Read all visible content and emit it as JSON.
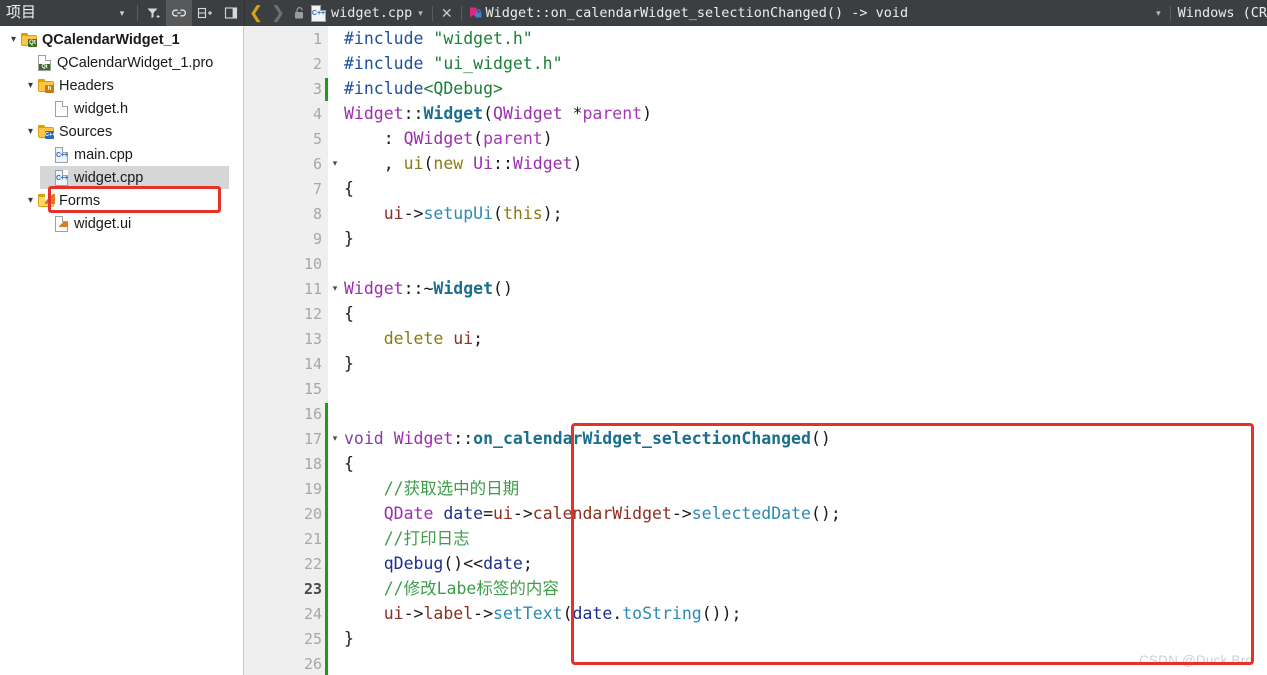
{
  "project_panel": {
    "title": "项目",
    "toolbar": [
      {
        "name": "dropdown-arrow-icon",
        "glyph": "▾"
      },
      {
        "name": "filter-icon",
        "glyph": "filter"
      },
      {
        "name": "link-icon",
        "glyph": "link",
        "active": true
      },
      {
        "name": "split-add-icon",
        "glyph": "split+"
      },
      {
        "name": "collapse-panel-icon",
        "glyph": "collapse"
      }
    ],
    "tree": [
      {
        "label": "QCalendarWidget_1",
        "depth": 0,
        "chevron": "▾",
        "icon": "qt-project-folder-icon",
        "bold": true,
        "selected": false
      },
      {
        "label": "QCalendarWidget_1.pro",
        "depth": 1,
        "chevron": "",
        "icon": "qt-pro-file-icon",
        "bold": false,
        "selected": false
      },
      {
        "label": "Headers",
        "depth": 1,
        "chevron": "▾",
        "icon": "headers-folder-icon",
        "bold": false,
        "selected": false
      },
      {
        "label": "widget.h",
        "depth": 2,
        "chevron": "",
        "icon": "header-file-icon",
        "bold": false,
        "selected": false
      },
      {
        "label": "Sources",
        "depth": 1,
        "chevron": "▾",
        "icon": "sources-folder-icon",
        "bold": false,
        "selected": false
      },
      {
        "label": "main.cpp",
        "depth": 2,
        "chevron": "",
        "icon": "cpp-file-icon",
        "bold": false,
        "selected": false
      },
      {
        "label": "widget.cpp",
        "depth": 2,
        "chevron": "",
        "icon": "cpp-file-icon",
        "bold": false,
        "selected": true
      },
      {
        "label": "Forms",
        "depth": 1,
        "chevron": "▾",
        "icon": "forms-folder-icon",
        "bold": false,
        "selected": false
      },
      {
        "label": "widget.ui",
        "depth": 2,
        "chevron": "",
        "icon": "ui-file-icon",
        "bold": false,
        "selected": false
      }
    ]
  },
  "editor_bar": {
    "back_glyph": "❮",
    "forward_glyph": "❯",
    "lock_icon": "unlocked-padlock-icon",
    "file_icon_label": "C++",
    "filename": "widget.cpp",
    "file_dropdown_glyph": "▾",
    "close_glyph": "✕",
    "symbol_icon": "bookmark-lock-icon",
    "symbol": "Widget::on_calendarWidget_selectionChanged() -> void",
    "symbol_dropdown_glyph": "▾",
    "line_ending": "Windows (CR"
  },
  "editor": {
    "current_line": 23,
    "change_marker_color": "#16a016",
    "highlight_color": "#e8302a",
    "lines": [
      {
        "n": 1,
        "fold": "",
        "change": false,
        "tokens": [
          {
            "t": "#include ",
            "c": "k-pre"
          },
          {
            "t": "\"widget.h\"",
            "c": "k-str"
          }
        ]
      },
      {
        "n": 2,
        "fold": "",
        "change": false,
        "tokens": [
          {
            "t": "#include ",
            "c": "k-pre"
          },
          {
            "t": "\"ui_widget.h\"",
            "c": "k-str"
          }
        ]
      },
      {
        "n": 3,
        "fold": "",
        "change": true,
        "tokens": [
          {
            "t": "#include",
            "c": "k-pre"
          },
          {
            "t": "<QDebug>",
            "c": "k-str"
          }
        ]
      },
      {
        "n": 4,
        "fold": "",
        "change": false,
        "tokens": [
          {
            "t": "Widget",
            "c": "k-type"
          },
          {
            "t": "::",
            "c": "k-op"
          },
          {
            "t": "Widget",
            "c": "k-fn"
          },
          {
            "t": "(",
            "c": "k-op"
          },
          {
            "t": "QWidget",
            "c": "k-type"
          },
          {
            "t": " *",
            "c": "k-op"
          },
          {
            "t": "parent",
            "c": "k-param"
          },
          {
            "t": ")",
            "c": "k-op"
          }
        ]
      },
      {
        "n": 5,
        "fold": "",
        "change": false,
        "tokens": [
          {
            "t": "    : ",
            "c": "k-op"
          },
          {
            "t": "QWidget",
            "c": "k-type"
          },
          {
            "t": "(",
            "c": "k-op"
          },
          {
            "t": "parent",
            "c": "k-param"
          },
          {
            "t": ")",
            "c": "k-op"
          }
        ]
      },
      {
        "n": 6,
        "fold": "▾",
        "change": false,
        "tokens": [
          {
            "t": "    , ",
            "c": "k-op"
          },
          {
            "t": "ui",
            "c": "k-kw"
          },
          {
            "t": "(",
            "c": "k-op"
          },
          {
            "t": "new",
            "c": "k-kw"
          },
          {
            "t": " ",
            "c": "k-op"
          },
          {
            "t": "Ui",
            "c": "k-type"
          },
          {
            "t": "::",
            "c": "k-op"
          },
          {
            "t": "Widget",
            "c": "k-type"
          },
          {
            "t": ")",
            "c": "k-op"
          }
        ]
      },
      {
        "n": 7,
        "fold": "",
        "change": false,
        "tokens": [
          {
            "t": "{",
            "c": "k-op"
          }
        ]
      },
      {
        "n": 8,
        "fold": "",
        "change": false,
        "tokens": [
          {
            "t": "    ",
            "c": "k-op"
          },
          {
            "t": "ui",
            "c": "k-var"
          },
          {
            "t": "->",
            "c": "k-op"
          },
          {
            "t": "setupUi",
            "c": "k-call"
          },
          {
            "t": "(",
            "c": "k-op"
          },
          {
            "t": "this",
            "c": "k-kw"
          },
          {
            "t": ");",
            "c": "k-op"
          }
        ]
      },
      {
        "n": 9,
        "fold": "",
        "change": false,
        "tokens": [
          {
            "t": "}",
            "c": "k-op"
          }
        ]
      },
      {
        "n": 10,
        "fold": "",
        "change": false,
        "tokens": []
      },
      {
        "n": 11,
        "fold": "▾",
        "change": false,
        "tokens": [
          {
            "t": "Widget",
            "c": "k-type"
          },
          {
            "t": "::~",
            "c": "k-op"
          },
          {
            "t": "Widget",
            "c": "k-fn"
          },
          {
            "t": "()",
            "c": "k-op"
          }
        ]
      },
      {
        "n": 12,
        "fold": "",
        "change": false,
        "tokens": [
          {
            "t": "{",
            "c": "k-op"
          }
        ]
      },
      {
        "n": 13,
        "fold": "",
        "change": false,
        "tokens": [
          {
            "t": "    ",
            "c": "k-op"
          },
          {
            "t": "delete",
            "c": "k-kw"
          },
          {
            "t": " ",
            "c": "k-op"
          },
          {
            "t": "ui",
            "c": "k-var"
          },
          {
            "t": ";",
            "c": "k-op"
          }
        ]
      },
      {
        "n": 14,
        "fold": "",
        "change": false,
        "tokens": [
          {
            "t": "}",
            "c": "k-op"
          }
        ]
      },
      {
        "n": 15,
        "fold": "",
        "change": false,
        "tokens": []
      },
      {
        "n": 16,
        "fold": "",
        "change": true,
        "tokens": []
      },
      {
        "n": 17,
        "fold": "▾",
        "change": true,
        "tokens": [
          {
            "t": "void",
            "c": "k-void"
          },
          {
            "t": " ",
            "c": "k-op"
          },
          {
            "t": "Widget",
            "c": "k-type"
          },
          {
            "t": "::",
            "c": "k-op"
          },
          {
            "t": "on_calendarWidget_selectionChanged",
            "c": "k-fn"
          },
          {
            "t": "()",
            "c": "k-op"
          }
        ]
      },
      {
        "n": 18,
        "fold": "",
        "change": true,
        "tokens": [
          {
            "t": "{",
            "c": "k-op"
          }
        ]
      },
      {
        "n": 19,
        "fold": "",
        "change": true,
        "tokens": [
          {
            "t": "    //获取选中的日期",
            "c": "k-cmt"
          }
        ]
      },
      {
        "n": 20,
        "fold": "",
        "change": true,
        "tokens": [
          {
            "t": "    ",
            "c": "k-op"
          },
          {
            "t": "QDate",
            "c": "k-type"
          },
          {
            "t": " ",
            "c": "k-op"
          },
          {
            "t": "date",
            "c": "k-var2"
          },
          {
            "t": "=",
            "c": "k-op"
          },
          {
            "t": "ui",
            "c": "k-var"
          },
          {
            "t": "->",
            "c": "k-op"
          },
          {
            "t": "calendarWidget",
            "c": "k-var"
          },
          {
            "t": "->",
            "c": "k-op"
          },
          {
            "t": "selectedDate",
            "c": "k-call"
          },
          {
            "t": "();",
            "c": "k-op"
          }
        ]
      },
      {
        "n": 21,
        "fold": "",
        "change": true,
        "tokens": [
          {
            "t": "    //打印日志",
            "c": "k-cmt"
          }
        ]
      },
      {
        "n": 22,
        "fold": "",
        "change": true,
        "tokens": [
          {
            "t": "    ",
            "c": "k-op"
          },
          {
            "t": "qDebug",
            "c": "k-var2"
          },
          {
            "t": "()<<",
            "c": "k-op"
          },
          {
            "t": "date",
            "c": "k-var2"
          },
          {
            "t": ";",
            "c": "k-op"
          }
        ]
      },
      {
        "n": 23,
        "fold": "",
        "change": true,
        "tokens": [
          {
            "t": "    //修改Labe标签的内容",
            "c": "k-cmt"
          }
        ]
      },
      {
        "n": 24,
        "fold": "",
        "change": true,
        "tokens": [
          {
            "t": "    ",
            "c": "k-op"
          },
          {
            "t": "ui",
            "c": "k-var"
          },
          {
            "t": "->",
            "c": "k-op"
          },
          {
            "t": "label",
            "c": "k-var"
          },
          {
            "t": "->",
            "c": "k-op"
          },
          {
            "t": "setText",
            "c": "k-call"
          },
          {
            "t": "(",
            "c": "k-op"
          },
          {
            "t": "date",
            "c": "k-var2"
          },
          {
            "t": ".",
            "c": "k-op"
          },
          {
            "t": "toString",
            "c": "k-call"
          },
          {
            "t": "());",
            "c": "k-op"
          }
        ]
      },
      {
        "n": 25,
        "fold": "",
        "change": true,
        "tokens": [
          {
            "t": "}",
            "c": "k-op"
          }
        ]
      },
      {
        "n": 26,
        "fold": "",
        "change": true,
        "tokens": []
      }
    ]
  },
  "watermark": "CSDN @Duck Bro"
}
